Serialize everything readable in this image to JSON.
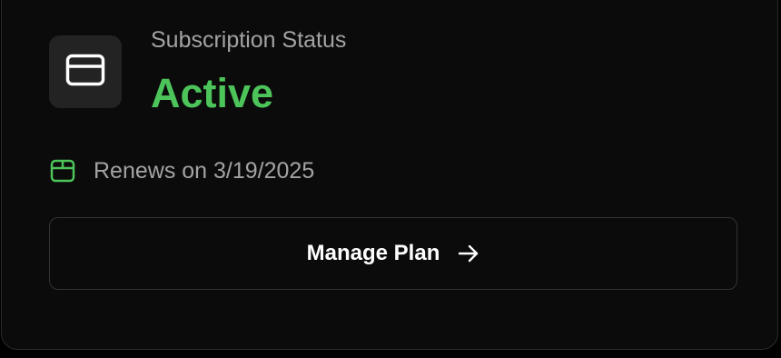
{
  "card": {
    "label": "Subscription Status",
    "status": "Active",
    "renewal_text": "Renews on 3/19/2025",
    "button_label": "Manage Plan"
  },
  "icons": {
    "tile_icon": "credit-card-icon",
    "renew_icon": "calendar-icon",
    "button_icon": "arrow-right-icon"
  },
  "colors": {
    "status_active": "#4cc45a",
    "renew_icon": "#4cc45a"
  }
}
